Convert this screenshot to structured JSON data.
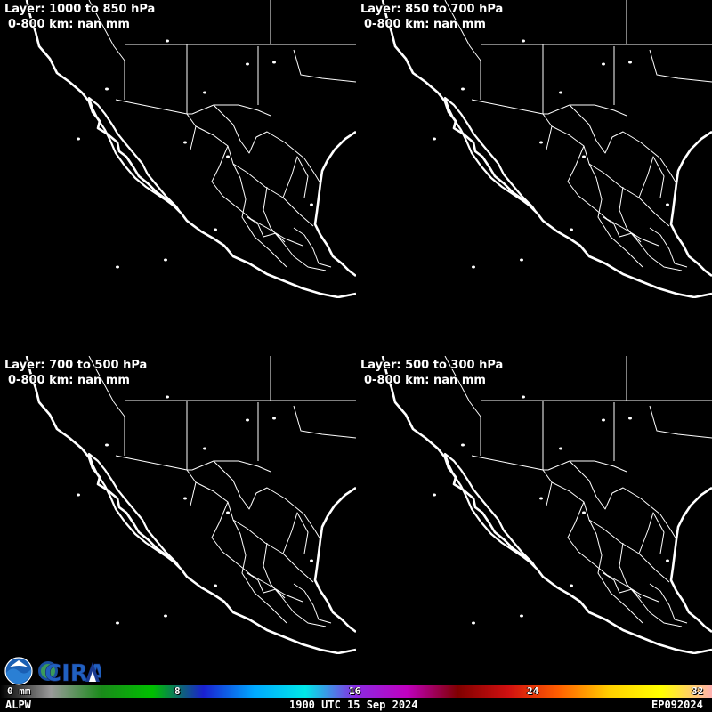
{
  "panels": [
    {
      "layer": "Layer: 1000 to 850 hPa",
      "range": "0-800 km: nan mm"
    },
    {
      "layer": "Layer: 850 to 700 hPa",
      "range": "0-800 km: nan mm"
    },
    {
      "layer": "Layer: 700 to 500 hPa",
      "range": "0-800 km: nan mm"
    },
    {
      "layer": "Layer: 500 to 300 hPa",
      "range": "0-800 km: nan mm"
    }
  ],
  "colorbar": {
    "labels": [
      "0 mm",
      "8",
      "16",
      "24",
      "32"
    ],
    "min": 0,
    "max": 32,
    "colors": [
      "#000000",
      "#9a9a9a",
      "#1a8a1a",
      "#00c000",
      "#1a20d0",
      "#00a8ff",
      "#00e8e8",
      "#8a2be2",
      "#c000c0",
      "#800000",
      "#d01010",
      "#ff6000",
      "#ffd000",
      "#ffff00",
      "#ffb0b0"
    ]
  },
  "logos": {
    "noaa": "noaa-logo",
    "cira": "CIRA"
  },
  "footer": {
    "left": "ALPW",
    "center": "1900 UTC 15 Sep 2024",
    "right": "EP092024"
  }
}
